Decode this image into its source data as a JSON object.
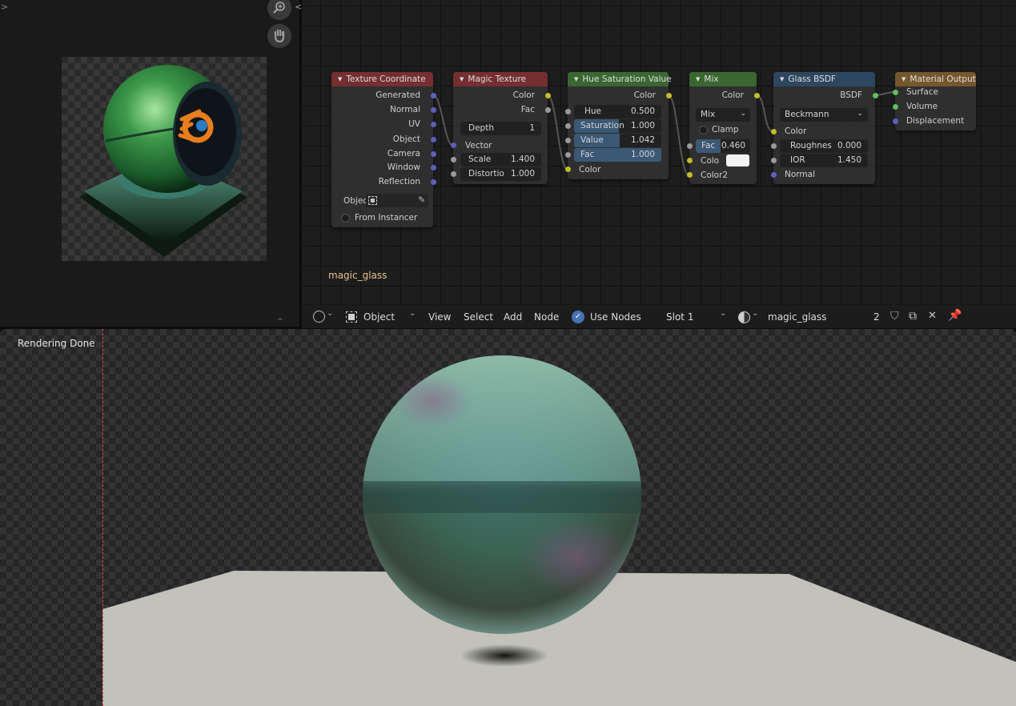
{
  "preview": {
    "expand_arrow": ">",
    "zoom_icon": "zoom-in-icon",
    "pan_icon": "hand-icon",
    "split_arrows": "<>"
  },
  "nodes": {
    "texture_coordinate": {
      "title": "Texture Coordinate",
      "color": "#7a2f33",
      "outputs": [
        "Generated",
        "Normal",
        "UV",
        "Object",
        "Camera",
        "Window",
        "Reflection"
      ],
      "object_label": "Objec",
      "from_instancer": "From Instancer"
    },
    "magic_texture": {
      "title": "Magic Texture",
      "color": "#7a2f33",
      "outputs": [
        "Color",
        "Fac"
      ],
      "depth": {
        "label": "Depth",
        "value": "1"
      },
      "vector": "Vector",
      "scale": {
        "label": "Scale",
        "value": "1.400"
      },
      "distortion": {
        "label": "Distortio",
        "value": "1.000"
      }
    },
    "hsv": {
      "title": "Hue Saturation Value",
      "color": "#3c6b33",
      "output": "Color",
      "hue": {
        "label": "Hue",
        "value": "0.500",
        "fill": 0
      },
      "saturation": {
        "label": "Saturation",
        "value": "1.000",
        "fill": 0.5
      },
      "value": {
        "label": "Value",
        "value": "1.042",
        "fill": 0.52
      },
      "fac": {
        "label": "Fac",
        "value": "1.000",
        "fill": 1
      },
      "input_color": "Color"
    },
    "mix": {
      "title": "Mix",
      "color": "#3c6b33",
      "output": "Color",
      "blend_type": "Mix",
      "clamp": "Clamp",
      "fac": {
        "label": "Fac",
        "value": "0.460"
      },
      "color1": "Colo",
      "color1_swatch": "#ffffff",
      "color2": "Color2"
    },
    "glass": {
      "title": "Glass BSDF",
      "color": "#2e4a65",
      "output": "BSDF",
      "distribution": "Beckmann",
      "color_in": "Color",
      "roughness": {
        "label": "Roughnes",
        "value": "0.000"
      },
      "ior": {
        "label": "IOR",
        "value": "1.450"
      },
      "normal": "Normal"
    },
    "output": {
      "title": "Material Output",
      "color": "#7a5a2e",
      "inputs": [
        "Surface",
        "Volume",
        "Displacement"
      ]
    }
  },
  "node_tree_label": "magic_glass",
  "header": {
    "editor_type_icon": "shader-editor-icon",
    "object_mode": "Object",
    "menus": [
      "View",
      "Select",
      "Add",
      "Node"
    ],
    "use_nodes": "Use Nodes",
    "slot": "Slot 1",
    "material_name": "magic_glass",
    "user_count": "2"
  },
  "render": {
    "status": "Rendering Done"
  }
}
